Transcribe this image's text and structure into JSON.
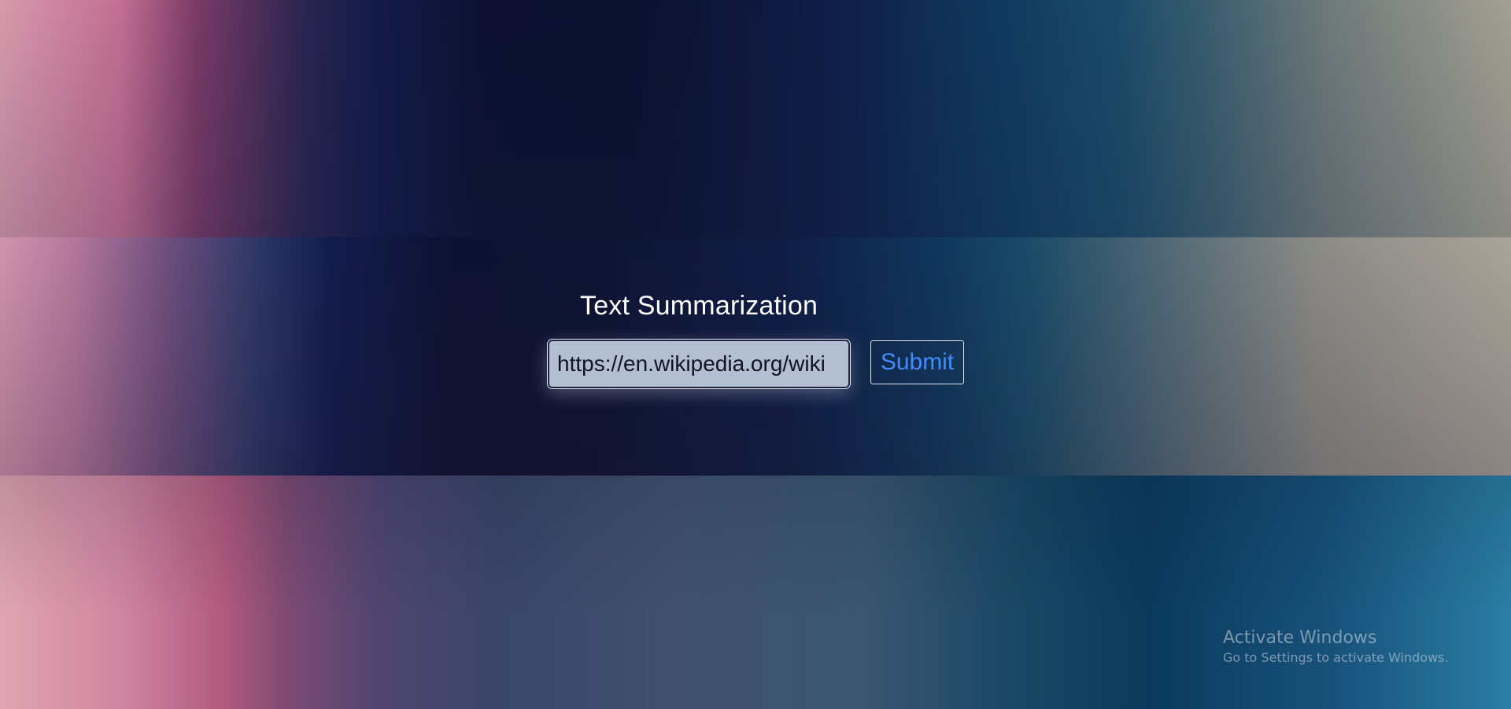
{
  "app": {
    "title": "Text Summarization"
  },
  "form": {
    "url_value": "https://en.wikipedia.org/wiki",
    "submit_label": "Submit"
  },
  "watermark": {
    "title": "Activate Windows",
    "subtitle": "Go to Settings to activate Windows."
  },
  "colors": {
    "submit_text": "#3f8cff",
    "input_background": "#b4bed1",
    "title_text": "#ffffff"
  }
}
